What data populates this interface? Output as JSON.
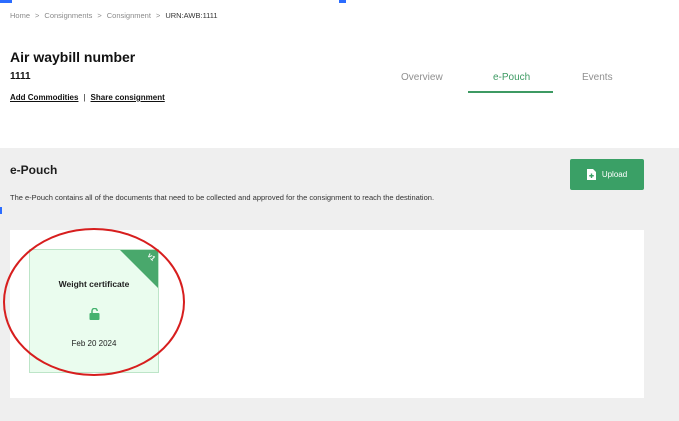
{
  "breadcrumb": {
    "items": [
      "Home",
      "Consignments",
      "Consignment"
    ],
    "separator": ">",
    "current": "URN:AWB:1111"
  },
  "consignment": {
    "title": "Air waybill number",
    "number": "1111",
    "add_commodities": "Add Commodities",
    "divider": "|",
    "share": "Share consignment"
  },
  "tabs": [
    {
      "label": "Overview",
      "active": false
    },
    {
      "label": "e-Pouch",
      "active": true
    },
    {
      "label": "Events",
      "active": false
    }
  ],
  "epouch": {
    "title": "e-Pouch",
    "description": "The e-Pouch contains all of the documents that need to be collected and approved for the consignment to reach the destination.",
    "upload_label": "Upload",
    "upload_icon": "file-plus-icon"
  },
  "documents": [
    {
      "name": "Weight certificate",
      "version": "v1",
      "status_icon": "unlocked-icon",
      "date": "Feb 20 2024"
    }
  ],
  "colors": {
    "accent_green": "#3aa066",
    "card_background": "#eafcee",
    "annotation_red": "#d71e1e"
  }
}
